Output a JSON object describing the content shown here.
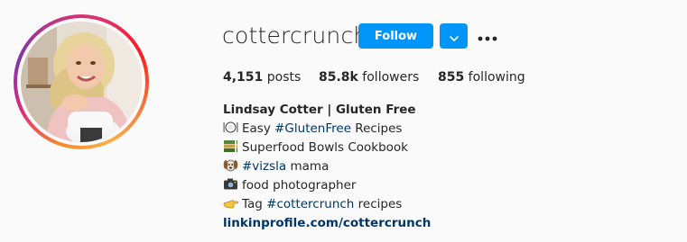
{
  "profile": {
    "username": "cottercrunch",
    "follow_label": "Follow",
    "dropdown_icon": "chevron-down-icon",
    "more_icon": "more-horizontal-icon",
    "avatar_icon": "profile-photo",
    "stats": {
      "posts_count": "4,151",
      "posts_label": " posts",
      "followers_count": "85.8k",
      "followers_label": " followers",
      "following_count": "855",
      "following_label": " following"
    },
    "bio": {
      "name": "Lindsay Cotter | Gluten Free",
      "line1_prefix": "Easy ",
      "line1_tag": "#GlutenFree",
      "line1_suffix": " Recipes",
      "line1_icon": "plate-cutlery-icon",
      "line2_text": "Superfood Bowls Cookbook",
      "line2_icon": "books-icon",
      "line3_tag": "#vizsla",
      "line3_suffix": " mama",
      "line3_icon": "dog-face-icon",
      "line4_text": "food photographer",
      "line4_icon": "camera-icon",
      "line5_prefix": "Tag ",
      "line5_tag": "#cottercrunch",
      "line5_suffix": " recipes",
      "line5_icon": "pointing-hand-icon",
      "link": "linkinprofile.com/cottercrunch"
    }
  },
  "colors": {
    "background": "#fafafa",
    "text": "#262626",
    "follow_blue": "#0095f6",
    "link_blue": "#00376b"
  }
}
